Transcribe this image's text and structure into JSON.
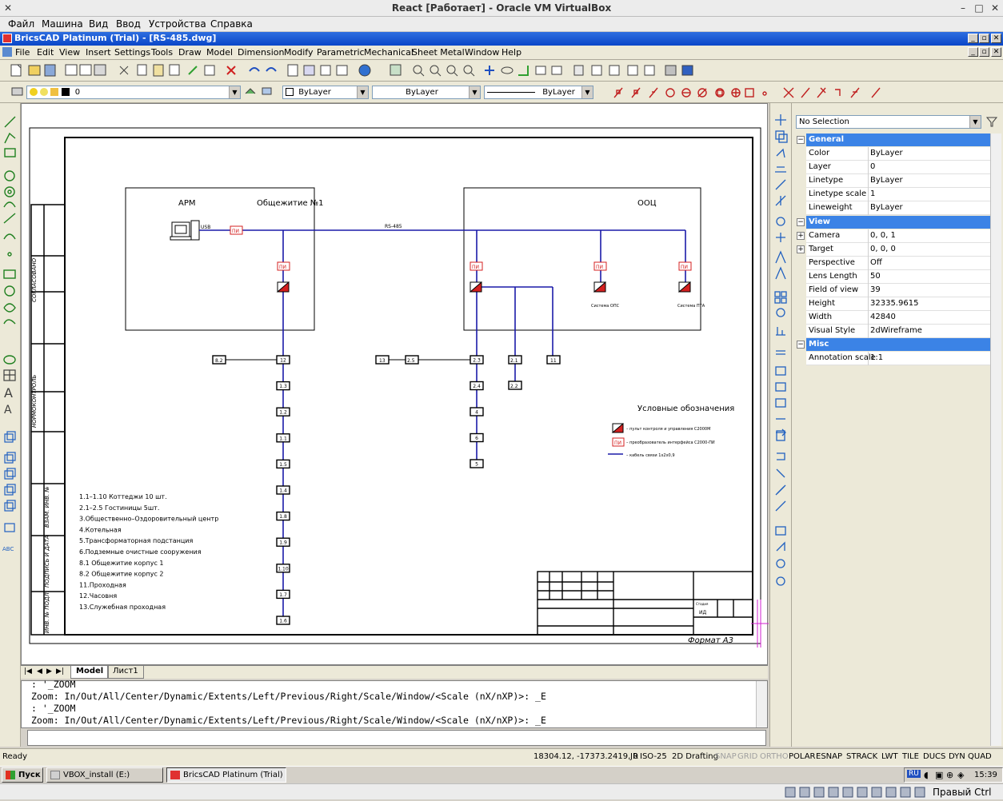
{
  "vbox": {
    "title": "React [Работает] - Oracle VM VirtualBox",
    "menu": [
      "Файл",
      "Машина",
      "Вид",
      "Ввод",
      "Устройства",
      "Справка"
    ],
    "host_key": "Правый Ctrl"
  },
  "app": {
    "title": "BricsCAD Platinum (Trial) - [RS-485.dwg]",
    "menu": [
      "File",
      "Edit",
      "View",
      "Insert",
      "Settings",
      "Tools",
      "Draw",
      "Model",
      "Dimension",
      "Modify",
      "Parametric",
      "Mechanical",
      "Sheet Metal",
      "Window",
      "Help"
    ]
  },
  "layerbar": {
    "layer": "0",
    "color": "ByLayer",
    "linetype": "ByLayer",
    "lineweight": "ByLayer"
  },
  "drawing": {
    "title_apm": "АРМ",
    "title_dorm": "Общежитие №1",
    "title_ooc": "ООЦ",
    "usb": "USB",
    "bus": "RS-485",
    "pi": "ПИ",
    "label_ops": "Система ОПС",
    "label_pta": "Система ПТА",
    "side_labels": [
      "СОГЛАСОВАНО",
      "НОРМОКОНТРОЛЬ",
      "ВЗАМ. ИНВ. №",
      "ПОДПИСЬ И ДАТА",
      "ИНВ. № ПОДЛ."
    ],
    "legend_title": "Условные обозначения",
    "legend": [
      "– пульт контроля и управления С2000М",
      "– преобразователь интерфейса С2000-ПИ",
      "– кабель связи 1х2х0,9"
    ],
    "notes": [
      "1.1–1.10   Коттеджи 10 шт.",
      "2.1–2.5   Гостиницы  5шт.",
      "3.Общественно–Оздоровительный центр",
      "4.Котельная",
      "5.Трансформаторная подстанция",
      "6.Подземные очистные сооружения",
      "8.1  Общежитие корпус 1",
      "8.2  Общежитие корпус 2",
      "11.Проходная",
      "12.Часовня",
      "13.Служебная проходная"
    ],
    "chain_left": [
      "12",
      "1.3",
      "1.2",
      "1.1",
      "1.5",
      "1.4",
      "1.8",
      "1.9",
      "1.10",
      "1.7",
      "1.6"
    ],
    "node_82": "8.2",
    "chain_mid": [
      "2.3",
      "2.4",
      "4",
      "6",
      "5"
    ],
    "node_13": "13",
    "node_25": "2.5",
    "node_21": "2.1",
    "node_22": "2.2",
    "node_11": "11",
    "format": "Формат А3",
    "stamp_stage": "Стадия",
    "stamp_id": "ИД"
  },
  "tabs": [
    "Model",
    "Лист1"
  ],
  "command_lines": [
    ": '_ZOOM",
    "Zoom:  In/Out/All/Center/Dynamic/Extents/Left/Previous/Right/Scale/Window/<Scale (nX/nXP)>: _E",
    ": '_ZOOM",
    "Zoom:  In/Out/All/Center/Dynamic/Extents/Left/Previous/Right/Scale/Window/<Scale (nX/nXP)>: _E"
  ],
  "properties": {
    "selection": "No Selection",
    "groups": {
      "general": "General",
      "view": "View",
      "misc": "Misc"
    },
    "general": [
      {
        "k": "Color",
        "v": "ByLayer"
      },
      {
        "k": "Layer",
        "v": "0"
      },
      {
        "k": "Linetype",
        "v": "ByLayer"
      },
      {
        "k": "Linetype scale",
        "v": "1"
      },
      {
        "k": "Lineweight",
        "v": "ByLayer"
      }
    ],
    "view": [
      {
        "k": "Camera",
        "v": "0, 0, 1"
      },
      {
        "k": "Target",
        "v": "0, 0, 0"
      },
      {
        "k": "Perspective",
        "v": "Off"
      },
      {
        "k": "Lens Length",
        "v": "50"
      },
      {
        "k": "Field of view",
        "v": "39"
      },
      {
        "k": "Height",
        "v": "32335.9615"
      },
      {
        "k": "Width",
        "v": "42840"
      },
      {
        "k": "Visual Style",
        "v": "2dWireframe"
      }
    ],
    "misc": [
      {
        "k": "Annotation scale",
        "v": "1:1"
      }
    ]
  },
  "status": {
    "ready": "Ready",
    "coords": "18304.12, -17373.2419, 0",
    "toggles": [
      "JR",
      "ISO-25",
      "2D Drafting",
      "SNAP",
      "GRID",
      "ORTHO",
      "POLAR",
      "ESNAP",
      "STRACK",
      "LWT",
      "TILE",
      "DUCS",
      "DYN",
      "QUAD"
    ],
    "off": [
      "SNAP",
      "GRID",
      "ORTHO"
    ]
  },
  "taskbar": {
    "start": "Пуск",
    "tasks": [
      "VBOX_install (E:)",
      "BricsCAD Platinum (Trial) - ..."
    ],
    "lang": "RU",
    "time": "15:39"
  },
  "colors": {
    "bus": "#1a1aa8",
    "pi_red": "#d42020",
    "title_blue": "#0a46c8",
    "group_blue": "#3b83e6"
  }
}
